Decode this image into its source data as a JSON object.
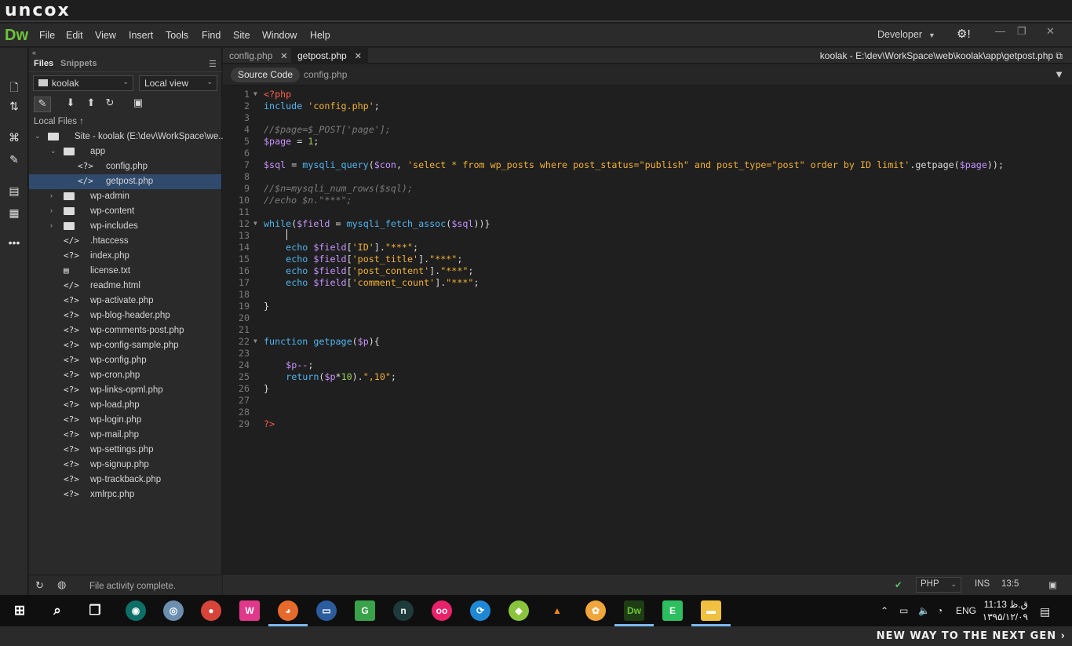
{
  "banner": {
    "logo": "uncox",
    "tagline": "NEW WAY TO THE NEXT GEN ›"
  },
  "app": {
    "logo": "Dw",
    "workspace": "Developer"
  },
  "menu": [
    "File",
    "Edit",
    "View",
    "Insert",
    "Tools",
    "Find",
    "Site",
    "Window",
    "Help"
  ],
  "files_panel": {
    "tabs": [
      "Files",
      "Snippets"
    ],
    "site_select": "koolak",
    "view_select": "Local view",
    "local_files_label": "Local Files",
    "status": "File activity complete.",
    "tree": [
      {
        "name": "Site - koolak (E:\\dev\\WorkSpace\\we...",
        "type": "site",
        "depth": 0,
        "expanded": true
      },
      {
        "name": "app",
        "type": "folder",
        "depth": 1,
        "expanded": true
      },
      {
        "name": "config.php",
        "type": "php",
        "depth": 2
      },
      {
        "name": "getpost.php",
        "type": "php-active",
        "depth": 2,
        "selected": true
      },
      {
        "name": "wp-admin",
        "type": "folder",
        "depth": 1,
        "expanded": false
      },
      {
        "name": "wp-content",
        "type": "folder",
        "depth": 1,
        "expanded": false
      },
      {
        "name": "wp-includes",
        "type": "folder",
        "depth": 1,
        "expanded": false
      },
      {
        "name": ".htaccess",
        "type": "code",
        "depth": 1
      },
      {
        "name": "index.php",
        "type": "php",
        "depth": 1
      },
      {
        "name": "license.txt",
        "type": "txt",
        "depth": 1
      },
      {
        "name": "readme.html",
        "type": "code",
        "depth": 1
      },
      {
        "name": "wp-activate.php",
        "type": "php",
        "depth": 1
      },
      {
        "name": "wp-blog-header.php",
        "type": "php",
        "depth": 1
      },
      {
        "name": "wp-comments-post.php",
        "type": "php",
        "depth": 1
      },
      {
        "name": "wp-config-sample.php",
        "type": "php",
        "depth": 1
      },
      {
        "name": "wp-config.php",
        "type": "php",
        "depth": 1
      },
      {
        "name": "wp-cron.php",
        "type": "php",
        "depth": 1
      },
      {
        "name": "wp-links-opml.php",
        "type": "php",
        "depth": 1
      },
      {
        "name": "wp-load.php",
        "type": "php",
        "depth": 1
      },
      {
        "name": "wp-login.php",
        "type": "php",
        "depth": 1
      },
      {
        "name": "wp-mail.php",
        "type": "php",
        "depth": 1
      },
      {
        "name": "wp-settings.php",
        "type": "php",
        "depth": 1
      },
      {
        "name": "wp-signup.php",
        "type": "php",
        "depth": 1
      },
      {
        "name": "wp-trackback.php",
        "type": "php",
        "depth": 1
      },
      {
        "name": "xmlrpc.php",
        "type": "php",
        "depth": 1
      }
    ]
  },
  "editor": {
    "tabs": [
      {
        "label": "config.php",
        "active": false
      },
      {
        "label": "getpost.php",
        "active": true
      }
    ],
    "path": "koolak - E:\\dev\\WorkSpace\\web\\koolak\\app\\getpost.php",
    "related": [
      "Source Code",
      "config.php"
    ],
    "lines": [
      [
        [
          "tag",
          "<?php"
        ]
      ],
      [
        [
          "kw",
          "include "
        ],
        [
          "str",
          "'config.php'"
        ],
        [
          "op",
          ";"
        ]
      ],
      [],
      [
        [
          "cm",
          "//$page=$_POST['page'];"
        ]
      ],
      [
        [
          "var",
          "$page"
        ],
        [
          "op",
          " = "
        ],
        [
          "num",
          "1"
        ],
        [
          "op",
          ";"
        ]
      ],
      [],
      [
        [
          "var",
          "$sql"
        ],
        [
          "op",
          " = "
        ],
        [
          "fn",
          "mysqli_query"
        ],
        [
          "op",
          "("
        ],
        [
          "var",
          "$con"
        ],
        [
          "op",
          ", "
        ],
        [
          "str",
          "'select * from wp_posts where post_status=\"publish\" and post_type=\"post\" order by ID limit'"
        ],
        [
          "op",
          ".getpage("
        ],
        [
          "var",
          "$page"
        ],
        [
          "op",
          "));"
        ]
      ],
      [],
      [
        [
          "cm",
          "//$n=mysqli_num_rows($sql);"
        ]
      ],
      [
        [
          "cm",
          "//echo $n.\"***\";"
        ]
      ],
      [],
      [
        [
          "kw",
          "while"
        ],
        [
          "op",
          "("
        ],
        [
          "var",
          "$field"
        ],
        [
          "op",
          " = "
        ],
        [
          "fn",
          "mysqli_fetch_assoc"
        ],
        [
          "op",
          "("
        ],
        [
          "var",
          "$sql"
        ],
        [
          "op",
          "))}"
        ]
      ],
      [],
      [
        [
          "op",
          "    "
        ],
        [
          "kw",
          "echo "
        ],
        [
          "var",
          "$field"
        ],
        [
          "op",
          "["
        ],
        [
          "str",
          "'ID'"
        ],
        [
          "op",
          "]."
        ],
        [
          "str",
          "\"***\""
        ],
        [
          "op",
          ";"
        ]
      ],
      [
        [
          "op",
          "    "
        ],
        [
          "kw",
          "echo "
        ],
        [
          "var",
          "$field"
        ],
        [
          "op",
          "["
        ],
        [
          "str",
          "'post_title'"
        ],
        [
          "op",
          "]."
        ],
        [
          "str",
          "\"***\""
        ],
        [
          "op",
          ";"
        ]
      ],
      [
        [
          "op",
          "    "
        ],
        [
          "kw",
          "echo "
        ],
        [
          "var",
          "$field"
        ],
        [
          "op",
          "["
        ],
        [
          "str",
          "'post_content'"
        ],
        [
          "op",
          "]."
        ],
        [
          "str",
          "\"***\""
        ],
        [
          "op",
          ";"
        ]
      ],
      [
        [
          "op",
          "    "
        ],
        [
          "kw",
          "echo "
        ],
        [
          "var",
          "$field"
        ],
        [
          "op",
          "["
        ],
        [
          "str",
          "'comment_count'"
        ],
        [
          "op",
          "]."
        ],
        [
          "str",
          "\"***\""
        ],
        [
          "op",
          ";"
        ]
      ],
      [],
      [
        [
          "op",
          "}"
        ]
      ],
      [],
      [],
      [
        [
          "kw",
          "function "
        ],
        [
          "fn",
          "getpage"
        ],
        [
          "op",
          "("
        ],
        [
          "var",
          "$p"
        ],
        [
          "op",
          "){"
        ]
      ],
      [],
      [
        [
          "op",
          "    "
        ],
        [
          "var",
          "$p--"
        ],
        [
          "op",
          ";"
        ]
      ],
      [
        [
          "op",
          "    "
        ],
        [
          "kw",
          "return"
        ],
        [
          "op",
          "("
        ],
        [
          "var",
          "$p"
        ],
        [
          "op",
          "*"
        ],
        [
          "num",
          "10"
        ],
        [
          "op",
          ")."
        ],
        [
          "str",
          "\",10\""
        ],
        [
          "op",
          ";"
        ]
      ],
      [
        [
          "op",
          "}"
        ]
      ],
      [],
      [],
      [
        [
          "tag",
          "?>"
        ]
      ]
    ],
    "fold_lines": [
      1,
      12,
      22
    ]
  },
  "status": {
    "language": "PHP",
    "mode": "INS",
    "position": "13:5"
  },
  "taskbar": {
    "apps": [
      "start",
      "search",
      "task-view",
      "gitkraken",
      "settings",
      "chrome",
      "wamp",
      "firefox",
      "desktop",
      "git",
      "nox",
      "flickr",
      "transfer",
      "android",
      "vlc",
      "paint",
      "dw",
      "evernote",
      "explorer"
    ],
    "lang": "ENG",
    "time": "11:13 ق.ظ",
    "date": "۱۳۹۵/۱۲/۰۹"
  }
}
